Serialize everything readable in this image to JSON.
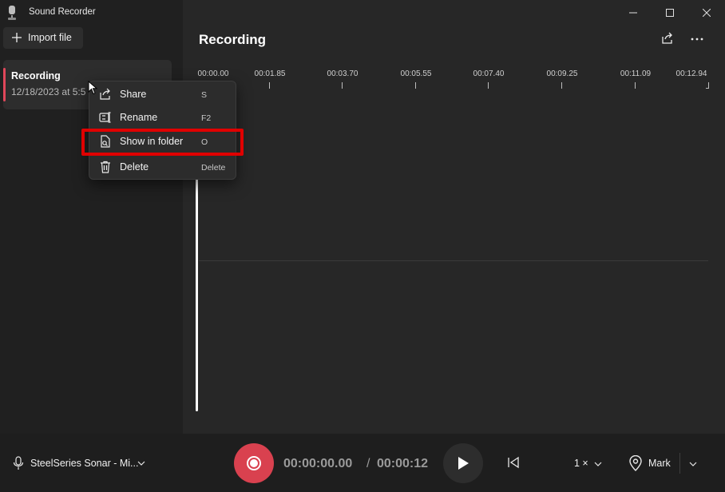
{
  "app": {
    "title": "Sound Recorder"
  },
  "sidebar": {
    "import_label": "Import file",
    "recordings": [
      {
        "name": "Recording",
        "date": "12/18/2023 at 5:5"
      }
    ]
  },
  "main": {
    "title": "Recording",
    "timeline_ticks": [
      "00:00.00",
      "00:01.85",
      "00:03.70",
      "00:05.55",
      "00:07.40",
      "00:09.25",
      "00:11.09",
      "00:12.94"
    ]
  },
  "context_menu": {
    "items": [
      {
        "label": "Share",
        "shortcut": "S",
        "icon": "share-icon"
      },
      {
        "label": "Rename",
        "shortcut": "F2",
        "icon": "rename-icon"
      },
      {
        "label": "Show in folder",
        "shortcut": "O",
        "icon": "folder-icon"
      },
      {
        "label": "Delete",
        "shortcut": "Delete",
        "icon": "trash-icon"
      }
    ]
  },
  "bottom": {
    "microphone": "SteelSeries Sonar - Mi...",
    "time_current": "00:00:00.00",
    "time_sep": "/",
    "time_total": "00:00:12",
    "speed": "1 ×",
    "mark_label": "Mark"
  },
  "colors": {
    "accent_record": "#d9414f",
    "highlight_outline": "#e00000",
    "selected_bar": "#e0475a"
  }
}
